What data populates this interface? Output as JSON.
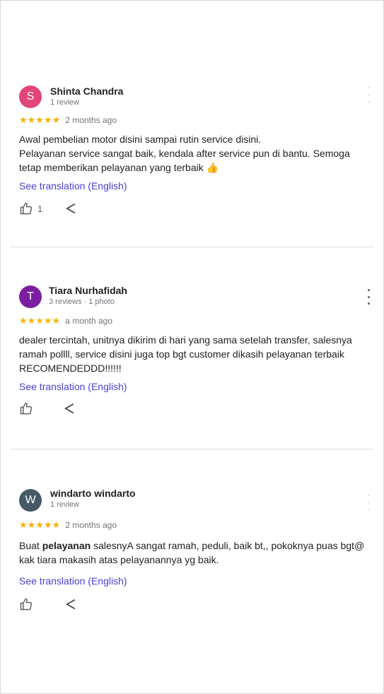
{
  "reviews": [
    {
      "author": "Shinta Chandra",
      "avatar_letter": "S",
      "avatar_color": "#e0457b",
      "meta": "1 review",
      "stars": "★★★★★",
      "time": "2 months ago",
      "text_line1": "Awal pembelian motor disini sampai rutin service disini.",
      "text_line2": "Pelayanan service sangat baik, kendala after service pun di bantu. Semoga tetap memberikan pelayanan yang terbaik 👍",
      "translate": "See translation (English)",
      "likes": "1",
      "menu_icon": "more-vert-icon"
    },
    {
      "author": "Tiara Nurhafidah",
      "avatar_letter": "T",
      "avatar_color": "#7b1fa2",
      "meta": "3 reviews · 1 photo",
      "stars": "★★★★★",
      "time": "a month ago",
      "text": "dealer tercintah, unitnya dikirim di hari yang sama setelah transfer, salesnya ramah pollll, service disini juga top bgt customer dikasih pelayanan terbaik RECOMENDEDDD!!!!!!",
      "translate": "See translation (English)",
      "menu_icon": "more-vert-icon"
    },
    {
      "author": "windarto windarto",
      "avatar_letter": "W",
      "avatar_color": "#455a64",
      "meta": "1 review",
      "stars": "★★★★★",
      "time": "2 months ago",
      "text_before": "Buat ",
      "text_bold": "pelayanan",
      "text_after": " salesnyA sangat ramah, peduli, baik bt,, pokoknya puas bgt@ kak tiara makasih atas pelayanannya yg baik.",
      "translate": "See translation (English)",
      "menu_icon": "more-vert-icon"
    }
  ],
  "colors": {
    "star": "#f4b400",
    "link": "#4a3fd0",
    "divider": "#dadce0"
  }
}
